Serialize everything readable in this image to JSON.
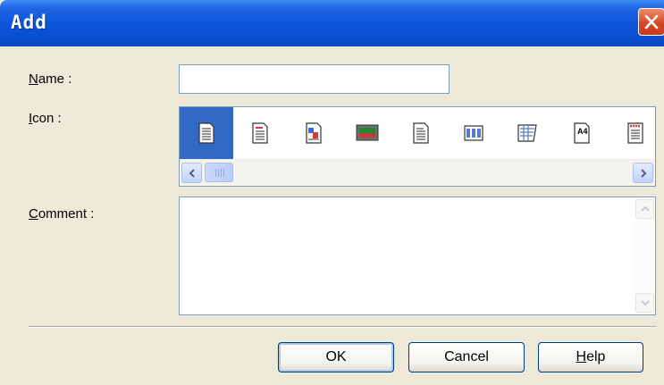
{
  "window": {
    "title": "Add"
  },
  "name": {
    "label_mnemonic": "N",
    "label_rest": "ame :",
    "value": ""
  },
  "icon": {
    "label_mnemonic": "I",
    "label_rest": "con :",
    "items": [
      {
        "name": "document-lines-icon",
        "selected": true
      },
      {
        "name": "document-red-lines-icon",
        "selected": false
      },
      {
        "name": "document-image-icon",
        "selected": false
      },
      {
        "name": "monitor-picture-icon",
        "selected": false
      },
      {
        "name": "document-plain-icon",
        "selected": false
      },
      {
        "name": "document-grid-icon",
        "selected": false
      },
      {
        "name": "document-diagonal-grid-icon",
        "selected": false
      },
      {
        "name": "a4-paper-icon",
        "text": "A4",
        "selected": false
      },
      {
        "name": "document-red-header-icon",
        "selected": false
      }
    ]
  },
  "comment": {
    "label_mnemonic": "C",
    "label_rest": "omment :",
    "value": ""
  },
  "buttons": {
    "ok": "OK",
    "cancel": "Cancel",
    "help_mnemonic": "H",
    "help_rest": "elp"
  },
  "colors": {
    "titlebar": "#0A54D6",
    "selection": "#316AC5",
    "face": "#ECE9D8",
    "close": "#D5492A"
  }
}
